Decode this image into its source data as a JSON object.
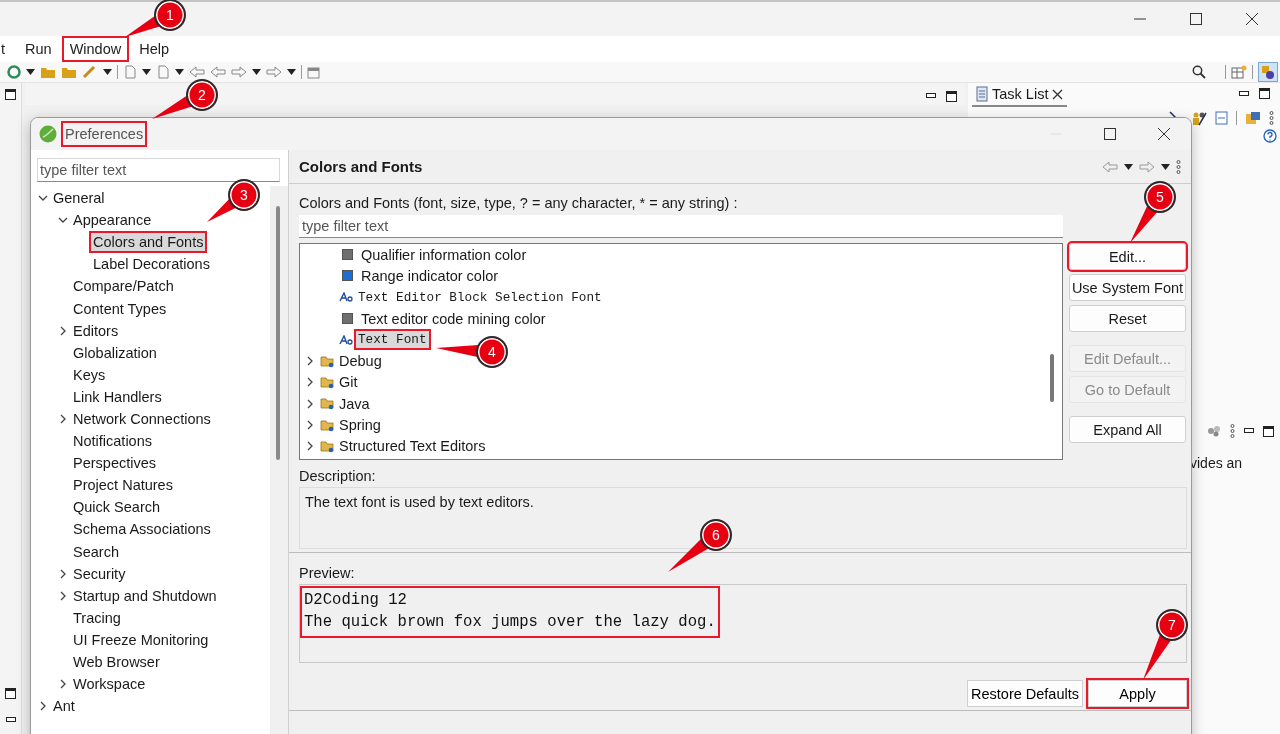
{
  "menu": [
    {
      "label": "t",
      "highlighted": false
    },
    {
      "label": "Run",
      "highlighted": false
    },
    {
      "label": "Window",
      "highlighted": true
    },
    {
      "label": "Help",
      "highlighted": false
    }
  ],
  "task_panel": {
    "tab": "Task List",
    "side_text": "vides an"
  },
  "dialog": {
    "title": "Preferences",
    "title_highlighted": true,
    "filter_placeholder": "type filter text",
    "tree": [
      {
        "label": "General",
        "kind": "node",
        "expanded": true,
        "selected": false,
        "children": [
          {
            "label": "Appearance",
            "kind": "node",
            "expanded": true,
            "selected": false,
            "children": [
              {
                "label": "Colors and Fonts",
                "kind": "leaf",
                "selected": true,
                "highlighted": true
              },
              {
                "label": "Label Decorations",
                "kind": "leaf",
                "selected": false
              }
            ]
          },
          {
            "label": "Compare/Patch",
            "kind": "leaf",
            "selected": false
          },
          {
            "label": "Content Types",
            "kind": "leaf",
            "selected": false
          },
          {
            "label": "Editors",
            "kind": "node",
            "expanded": false,
            "selected": false
          },
          {
            "label": "Globalization",
            "kind": "leaf",
            "selected": false
          },
          {
            "label": "Keys",
            "kind": "leaf",
            "selected": false
          },
          {
            "label": "Link Handlers",
            "kind": "leaf",
            "selected": false
          },
          {
            "label": "Network Connections",
            "kind": "node",
            "expanded": false,
            "selected": false
          },
          {
            "label": "Notifications",
            "kind": "leaf",
            "selected": false
          },
          {
            "label": "Perspectives",
            "kind": "leaf",
            "selected": false
          },
          {
            "label": "Project Natures",
            "kind": "leaf",
            "selected": false
          },
          {
            "label": "Quick Search",
            "kind": "leaf",
            "selected": false
          },
          {
            "label": "Schema Associations",
            "kind": "leaf",
            "selected": false
          },
          {
            "label": "Search",
            "kind": "leaf",
            "selected": false
          },
          {
            "label": "Security",
            "kind": "node",
            "expanded": false,
            "selected": false
          },
          {
            "label": "Startup and Shutdown",
            "kind": "node",
            "expanded": false,
            "selected": false
          },
          {
            "label": "Tracing",
            "kind": "leaf",
            "selected": false
          },
          {
            "label": "UI Freeze Monitoring",
            "kind": "leaf",
            "selected": false
          },
          {
            "label": "Web Browser",
            "kind": "leaf",
            "selected": false
          },
          {
            "label": "Workspace",
            "kind": "node",
            "expanded": false,
            "selected": false
          }
        ]
      },
      {
        "label": "Ant",
        "kind": "node",
        "expanded": false,
        "selected": false
      }
    ],
    "page": {
      "title": "Colors and Fonts",
      "filter_label": "Colors and Fonts (font, size, type, ? = any character, * = any string) :",
      "filter_placeholder": "type filter text",
      "items": [
        {
          "label": "Qualifier information color",
          "kind": "color",
          "color": "#6e6e6e",
          "selected": false
        },
        {
          "label": "Range indicator color",
          "kind": "color",
          "color": "#1a6fd6",
          "selected": false
        },
        {
          "label": "Text Editor Block Selection Font",
          "kind": "font",
          "selected": false
        },
        {
          "label": "Text editor code mining color",
          "kind": "color",
          "color": "#6e6e6e",
          "selected": false
        },
        {
          "label": "Text Font",
          "kind": "font",
          "selected": true,
          "highlighted": true
        },
        {
          "label": "Debug",
          "kind": "category",
          "expanded": false,
          "selected": false
        },
        {
          "label": "Git",
          "kind": "category",
          "expanded": false,
          "selected": false
        },
        {
          "label": "Java",
          "kind": "category",
          "expanded": false,
          "selected": false
        },
        {
          "label": "Spring",
          "kind": "category",
          "expanded": false,
          "selected": false
        },
        {
          "label": "Structured Text Editors",
          "kind": "category",
          "expanded": false,
          "selected": false
        }
      ],
      "buttons": [
        {
          "label": "Edit...",
          "disabled": false,
          "highlighted": true
        },
        {
          "label": "Use System Font",
          "disabled": false,
          "highlighted": false
        },
        {
          "label": "Reset",
          "disabled": false,
          "highlighted": false
        },
        {
          "label": "Edit Default...",
          "disabled": true,
          "highlighted": false
        },
        {
          "label": "Go to Default",
          "disabled": true,
          "highlighted": false
        },
        {
          "label": "Expand All",
          "disabled": false,
          "highlighted": false
        }
      ],
      "description_label": "Description:",
      "description": "The text font is used by text editors.",
      "preview_label": "Preview:",
      "preview": {
        "lines": [
          "D2Coding 12",
          "The quick brown fox jumps over the lazy dog."
        ],
        "highlighted": true
      },
      "actions": [
        {
          "label": "Restore Defaults",
          "highlighted": false
        },
        {
          "label": "Apply",
          "highlighted": true
        }
      ]
    }
  },
  "annotations": [
    {
      "number": "1"
    },
    {
      "number": "2"
    },
    {
      "number": "3"
    },
    {
      "number": "4"
    },
    {
      "number": "5"
    },
    {
      "number": "6"
    },
    {
      "number": "7"
    }
  ]
}
